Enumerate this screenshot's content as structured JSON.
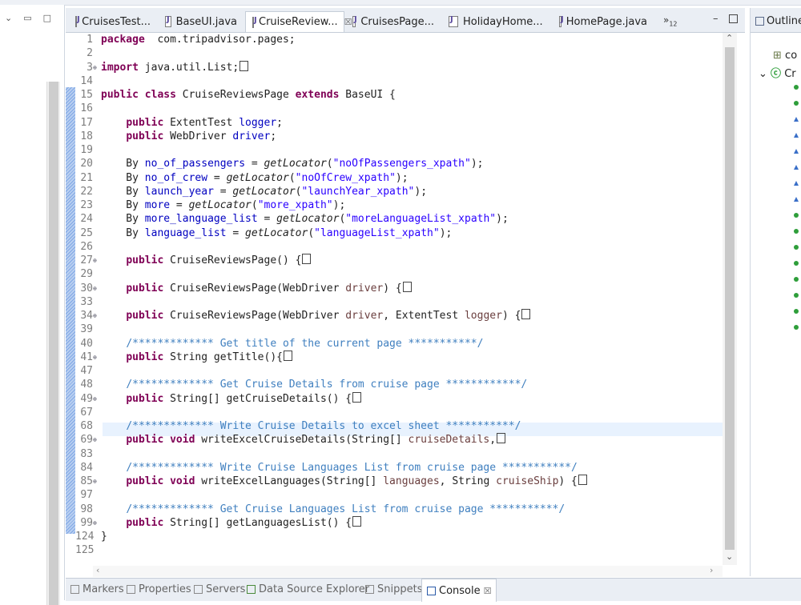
{
  "editor_tabs": [
    {
      "label": "CruisesTest...",
      "active": false
    },
    {
      "label": "BaseUI.java",
      "active": false
    },
    {
      "label": "CruiseReview...",
      "active": true,
      "close": "☒"
    },
    {
      "label": "CruisesPage...",
      "active": false
    },
    {
      "label": "HolidayHome...",
      "active": false
    },
    {
      "label": "HomePage.java",
      "active": false
    }
  ],
  "tab_overflow": {
    "symbol": "»",
    "count": "12"
  },
  "code_lines": [
    {
      "n": "1",
      "fold": "",
      "t": [
        [
          "kw",
          "package"
        ],
        [
          "",
          "  com.tripadvisor.pages;"
        ]
      ]
    },
    {
      "n": "2",
      "fold": "",
      "t": []
    },
    {
      "n": "3",
      "fold": "⊕",
      "t": [
        [
          "kw",
          "import"
        ],
        [
          "",
          " java.util.List;"
        ],
        [
          "box",
          ""
        ]
      ]
    },
    {
      "n": "14",
      "fold": "",
      "t": []
    },
    {
      "n": "15",
      "fold": "",
      "t": [
        [
          "kw",
          "public class"
        ],
        [
          "",
          " CruiseReviewsPage "
        ],
        [
          "kw",
          "extends"
        ],
        [
          "",
          " BaseUI {"
        ]
      ]
    },
    {
      "n": "16",
      "fold": "",
      "t": []
    },
    {
      "n": "17",
      "fold": "",
      "t": [
        [
          "",
          "    "
        ],
        [
          "kw",
          "public"
        ],
        [
          "",
          " ExtentTest "
        ],
        [
          "field",
          "logger"
        ],
        [
          "",
          ";"
        ]
      ]
    },
    {
      "n": "18",
      "fold": "",
      "t": [
        [
          "",
          "    "
        ],
        [
          "kw",
          "public"
        ],
        [
          "",
          " WebDriver "
        ],
        [
          "field",
          "driver"
        ],
        [
          "",
          ";"
        ]
      ]
    },
    {
      "n": "19",
      "fold": "",
      "t": []
    },
    {
      "n": "20",
      "fold": "",
      "t": [
        [
          "",
          "    By "
        ],
        [
          "field",
          "no_of_passengers"
        ],
        [
          "",
          " = "
        ],
        [
          "meth",
          "getLocator"
        ],
        [
          "",
          "("
        ],
        [
          "str",
          "\"noOfPassengers_xpath\""
        ],
        [
          "",
          ");"
        ]
      ]
    },
    {
      "n": "21",
      "fold": "",
      "t": [
        [
          "",
          "    By "
        ],
        [
          "field",
          "no_of_crew"
        ],
        [
          "",
          " = "
        ],
        [
          "meth",
          "getLocator"
        ],
        [
          "",
          "("
        ],
        [
          "str",
          "\"noOfCrew_xpath\""
        ],
        [
          "",
          ");"
        ]
      ]
    },
    {
      "n": "22",
      "fold": "",
      "t": [
        [
          "",
          "    By "
        ],
        [
          "field",
          "launch_year"
        ],
        [
          "",
          " = "
        ],
        [
          "meth",
          "getLocator"
        ],
        [
          "",
          "("
        ],
        [
          "str",
          "\"launchYear_xpath\""
        ],
        [
          "",
          ");"
        ]
      ]
    },
    {
      "n": "23",
      "fold": "",
      "t": [
        [
          "",
          "    By "
        ],
        [
          "field",
          "more"
        ],
        [
          "",
          " = "
        ],
        [
          "meth",
          "getLocator"
        ],
        [
          "",
          "("
        ],
        [
          "str",
          "\"more_xpath\""
        ],
        [
          "",
          ");"
        ]
      ]
    },
    {
      "n": "24",
      "fold": "",
      "t": [
        [
          "",
          "    By "
        ],
        [
          "field",
          "more_language_list"
        ],
        [
          "",
          " = "
        ],
        [
          "meth",
          "getLocator"
        ],
        [
          "",
          "("
        ],
        [
          "str",
          "\"moreLanguageList_xpath\""
        ],
        [
          "",
          ");"
        ]
      ]
    },
    {
      "n": "25",
      "fold": "",
      "t": [
        [
          "",
          "    By "
        ],
        [
          "field",
          "language_list"
        ],
        [
          "",
          " = "
        ],
        [
          "meth",
          "getLocator"
        ],
        [
          "",
          "("
        ],
        [
          "str",
          "\"languageList_xpath\""
        ],
        [
          "",
          ");"
        ]
      ]
    },
    {
      "n": "26",
      "fold": "",
      "t": []
    },
    {
      "n": "27",
      "fold": "⊕",
      "t": [
        [
          "",
          "    "
        ],
        [
          "kw",
          "public"
        ],
        [
          "",
          " CruiseReviewsPage() {"
        ],
        [
          "box",
          ""
        ]
      ]
    },
    {
      "n": "29",
      "fold": "",
      "t": []
    },
    {
      "n": "30",
      "fold": "⊕",
      "t": [
        [
          "",
          "    "
        ],
        [
          "kw",
          "public"
        ],
        [
          "",
          " CruiseReviewsPage(WebDriver "
        ],
        [
          "param",
          "driver"
        ],
        [
          "",
          ") {"
        ],
        [
          "box",
          ""
        ]
      ]
    },
    {
      "n": "33",
      "fold": "",
      "t": []
    },
    {
      "n": "34",
      "fold": "⊕",
      "t": [
        [
          "",
          "    "
        ],
        [
          "kw",
          "public"
        ],
        [
          "",
          " CruiseReviewsPage(WebDriver "
        ],
        [
          "param",
          "driver"
        ],
        [
          "",
          ", ExtentTest "
        ],
        [
          "param",
          "logger"
        ],
        [
          "",
          ") {"
        ],
        [
          "box",
          ""
        ]
      ]
    },
    {
      "n": "39",
      "fold": "",
      "t": []
    },
    {
      "n": "40",
      "fold": "",
      "t": [
        [
          "",
          "    "
        ],
        [
          "cmt",
          "/************* Get title of the current page ***********/"
        ]
      ]
    },
    {
      "n": "41",
      "fold": "⊕",
      "t": [
        [
          "",
          "    "
        ],
        [
          "kw",
          "public"
        ],
        [
          "",
          " String getTitle(){"
        ],
        [
          "box",
          ""
        ]
      ]
    },
    {
      "n": "47",
      "fold": "",
      "t": []
    },
    {
      "n": "48",
      "fold": "",
      "t": [
        [
          "",
          "    "
        ],
        [
          "cmt",
          "/************* Get Cruise Details from cruise page ************/"
        ]
      ]
    },
    {
      "n": "49",
      "fold": "⊕",
      "t": [
        [
          "",
          "    "
        ],
        [
          "kw",
          "public"
        ],
        [
          "",
          " String[] getCruiseDetails() {"
        ],
        [
          "box",
          ""
        ]
      ]
    },
    {
      "n": "67",
      "fold": "",
      "t": []
    },
    {
      "n": "68",
      "fold": "",
      "t": [
        [
          "",
          "    "
        ],
        [
          "cmt",
          "/************* Write Cruise Details to excel sheet ***********/"
        ]
      ]
    },
    {
      "n": "69",
      "fold": "⊕",
      "t": [
        [
          "",
          "    "
        ],
        [
          "kw",
          "public void"
        ],
        [
          "",
          " writeExcelCruiseDetails(String[] "
        ],
        [
          "param",
          "cruiseDetails"
        ],
        [
          "",
          ","
        ],
        [
          "box",
          ""
        ]
      ]
    },
    {
      "n": "83",
      "fold": "",
      "t": []
    },
    {
      "n": "84",
      "fold": "",
      "t": [
        [
          "",
          "    "
        ],
        [
          "cmt",
          "/************* Write Cruise Languages List from cruise page ***********/"
        ]
      ]
    },
    {
      "n": "85",
      "fold": "⊕",
      "t": [
        [
          "",
          "    "
        ],
        [
          "kw",
          "public void"
        ],
        [
          "",
          " writeExcelLanguages(String[] "
        ],
        [
          "param",
          "languages"
        ],
        [
          "",
          ", String "
        ],
        [
          "param",
          "cruiseShip"
        ],
        [
          "",
          ") {"
        ],
        [
          "box",
          ""
        ]
      ]
    },
    {
      "n": "97",
      "fold": "",
      "t": []
    },
    {
      "n": "98",
      "fold": "",
      "t": [
        [
          "",
          "    "
        ],
        [
          "cmt",
          "/************* Get Cruise Languages List from cruise page ***********/"
        ]
      ]
    },
    {
      "n": "99",
      "fold": "⊕",
      "t": [
        [
          "",
          "    "
        ],
        [
          "kw",
          "public"
        ],
        [
          "",
          " String[] getLanguagesList() {"
        ],
        [
          "box",
          ""
        ]
      ]
    },
    {
      "n": "124",
      "fold": "",
      "t": [
        [
          "",
          "}"
        ]
      ]
    },
    {
      "n": "125",
      "fold": "",
      "t": []
    }
  ],
  "outline": {
    "title": "Outline",
    "items": [
      {
        "label": "co",
        "icon": "import-container-icon"
      },
      {
        "label": "Cr",
        "icon": "class-icon",
        "expanded": true
      }
    ],
    "member_colors": [
      "#2e9e3a",
      "#2e9e3a",
      "#3a6fc8",
      "#3a6fc8",
      "#3a6fc8",
      "#3a6fc8",
      "#3a6fc8",
      "#3a6fc8",
      "#2e9e3a",
      "#2e9e3a",
      "#2e9e3a",
      "#2e9e3a",
      "#2e9e3a",
      "#2e9e3a",
      "#2e9e3a",
      "#2e9e3a"
    ]
  },
  "bottom_tabs": [
    {
      "label": "Markers",
      "active": false
    },
    {
      "label": "Properties",
      "active": false
    },
    {
      "label": "Servers",
      "active": false
    },
    {
      "label": "Data Source Explorer",
      "active": false
    },
    {
      "label": "Snippets",
      "active": false
    },
    {
      "label": "Console",
      "active": true,
      "close": "☒"
    }
  ]
}
